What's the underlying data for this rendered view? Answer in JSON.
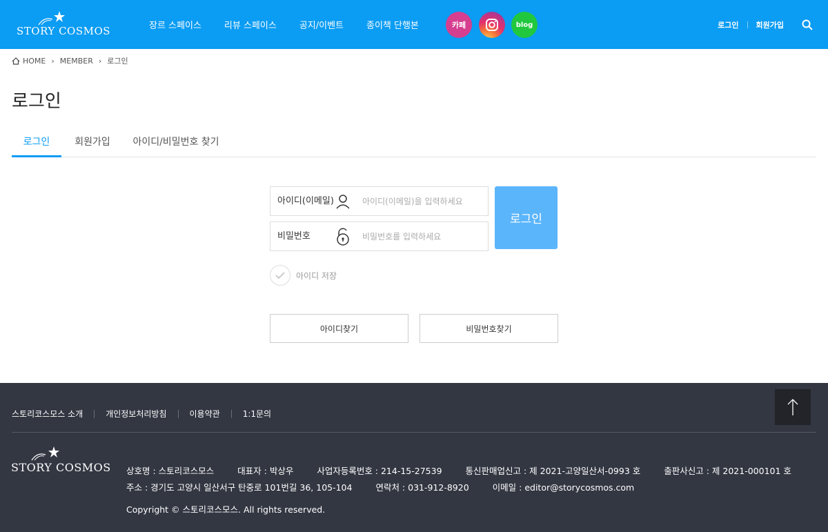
{
  "header": {
    "logo_text": "STORY COSMOS",
    "nav": [
      "장르 스페이스",
      "리뷰 스페이스",
      "공지/이벤트",
      "종이책 단행본"
    ],
    "social": {
      "cafe": "카페",
      "blog": "blog"
    },
    "login": "로그인",
    "signup": "회원가입"
  },
  "breadcrumb": {
    "home": "HOME",
    "member": "MEMBER",
    "current": "로그인"
  },
  "page_title": "로그인",
  "tabs": [
    "로그인",
    "회원가입",
    "아이디/비밀번호 찾기"
  ],
  "form": {
    "id_label": "아이디(이메일)",
    "id_placeholder": "아이디(이메일)을 입력하세요",
    "pw_label": "비밀번호",
    "pw_placeholder": "비밀번호를 입력하세요",
    "login_button": "로그인",
    "save_id": "아이디 저장",
    "find_id": "아이디찾기",
    "find_pw": "비밀번호찾기"
  },
  "footer": {
    "links": [
      "스토리코스모스 소개",
      "개인정보처리방침",
      "이용약관",
      "1:1문의"
    ],
    "logo_text": "STORY COSMOS",
    "info_row1": [
      "상호명 : 스토리코스모스",
      "대표자 : 박상우",
      "사업자등록번호 : 214-15-27539",
      "통신판매업신고 : 제 2021-고양일산서-0993 호",
      "출판사신고 : 제 2021-000101 호"
    ],
    "info_row2": [
      "주소 : 경기도 고양시 일산서구 탄중로 101번길 36, 105-104",
      "연락처 : 031-912-8920",
      "이메일 : editor@storycosmos.com"
    ],
    "copyright": "Copyright © 스토리코스모스. All rights reserved."
  },
  "colors": {
    "brand": "#0b9cf3",
    "login_button": "#5bb5fb",
    "footer_bg": "#333742"
  }
}
